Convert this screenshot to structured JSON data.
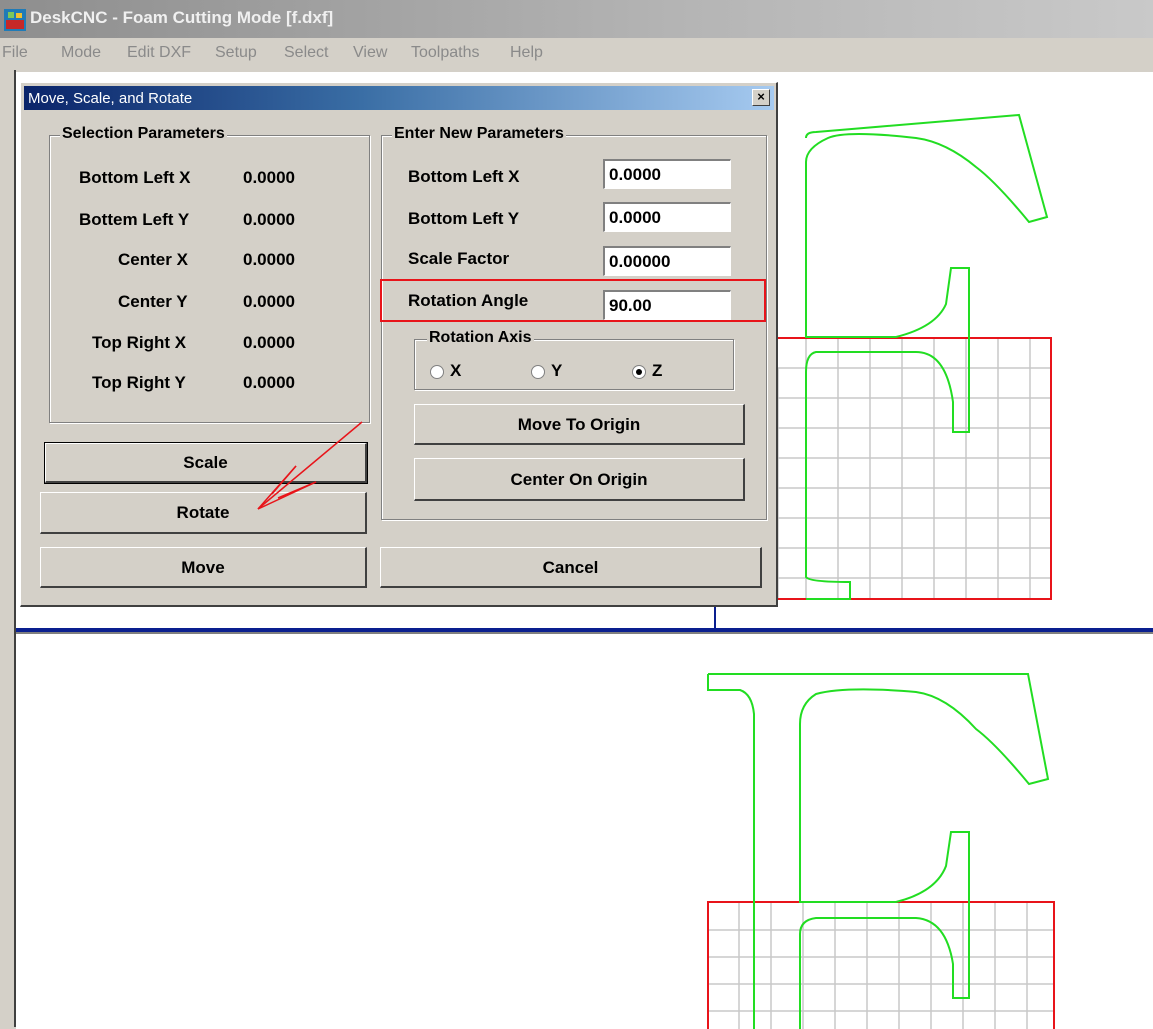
{
  "window": {
    "title": "DeskCNC - Foam Cutting Mode [f.dxf]"
  },
  "menu": [
    "File",
    "Mode",
    "Edit DXF",
    "Setup",
    "Select",
    "View",
    "Toolpaths",
    "Help"
  ],
  "dialog": {
    "title": "Move, Scale, and Rotate",
    "close": "×",
    "selection": {
      "title": "Selection Parameters",
      "rows": [
        {
          "label": "Bottom Left X",
          "value": "0.0000"
        },
        {
          "label": "Bottem Left Y",
          "value": "0.0000"
        },
        {
          "label": "Center X",
          "value": "0.0000"
        },
        {
          "label": "Center Y",
          "value": "0.0000"
        },
        {
          "label": "Top Right X",
          "value": "0.0000"
        },
        {
          "label": "Top Right Y",
          "value": "0.0000"
        }
      ]
    },
    "new_params": {
      "title": "Enter New Parameters",
      "rows": [
        {
          "label": "Bottom Left X",
          "value": "0.0000"
        },
        {
          "label": "Bottom Left Y",
          "value": "0.0000"
        },
        {
          "label": "Scale Factor",
          "value": "0.00000"
        },
        {
          "label": "Rotation Angle",
          "value": "90.00"
        }
      ]
    },
    "axis": {
      "title": "Rotation Axis",
      "options": [
        {
          "label": "X",
          "selected": false
        },
        {
          "label": "Y",
          "selected": false
        },
        {
          "label": "Z",
          "selected": true
        }
      ]
    },
    "buttons": {
      "scale": "Scale",
      "rotate": "Rotate",
      "move": "Move",
      "cancel": "Cancel",
      "move_to_origin": "Move To Origin",
      "center_on_origin": "Center On Origin"
    }
  },
  "colors": {
    "grid": "#c8c8c8",
    "stock": "#e8141a",
    "part": "#22dd22",
    "annotation": "#e8141a",
    "axis": "#0a1f8f"
  }
}
